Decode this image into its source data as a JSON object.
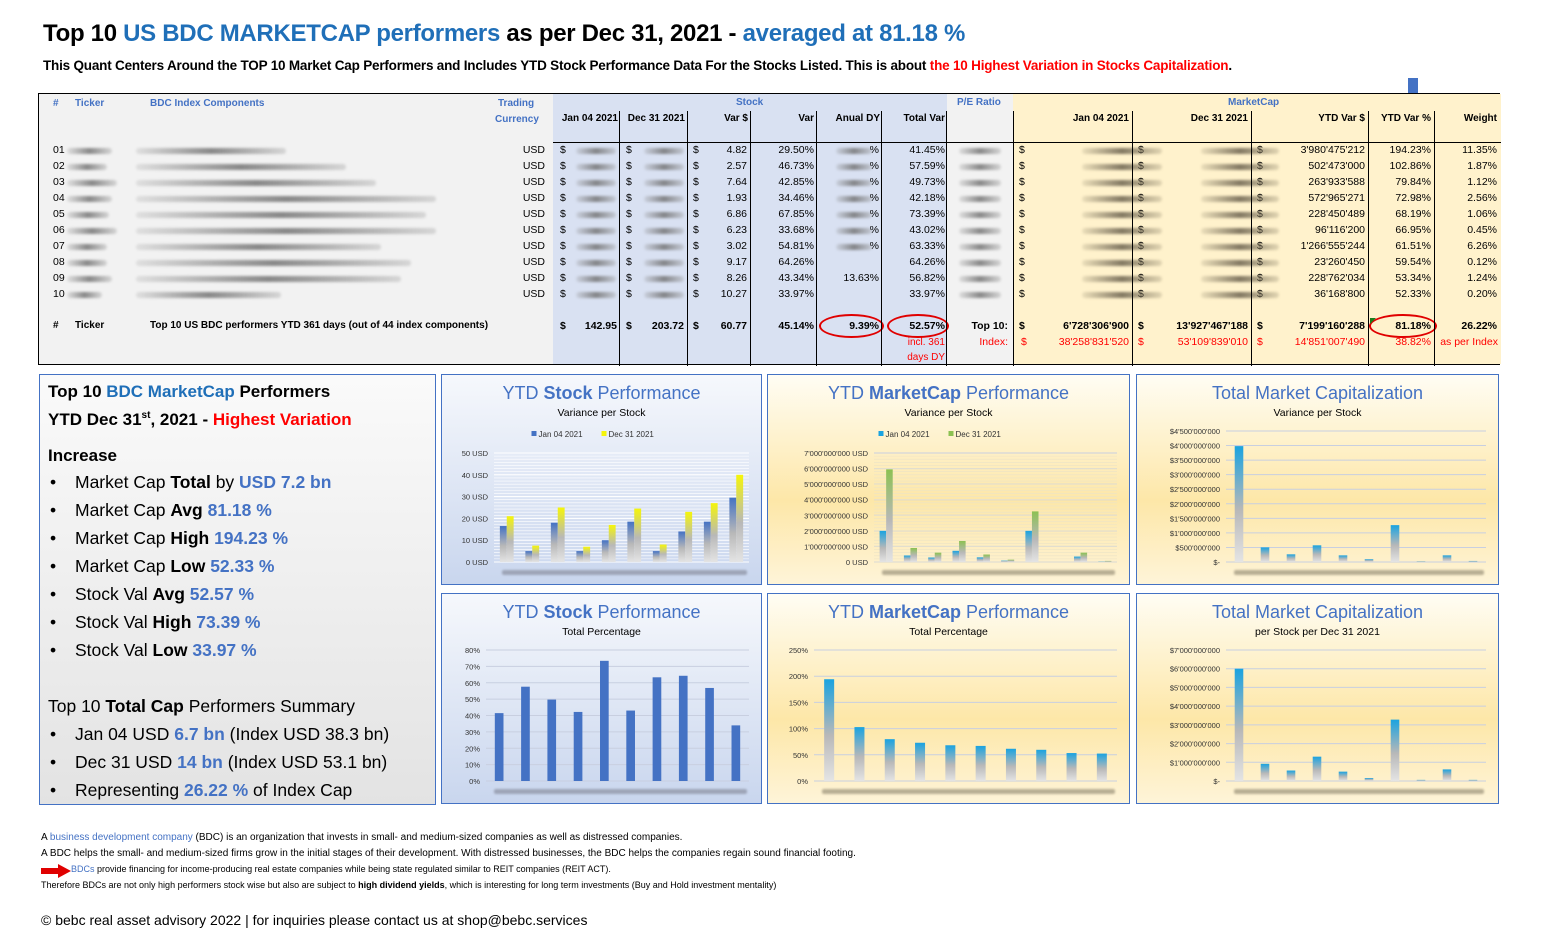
{
  "header": {
    "title_part1": "Top 10 ",
    "title_part2": "US BDC MARKETCAP performers",
    "title_part3": " as per Dec 31, 2021 -  ",
    "title_part4": "averaged at 81.18 %",
    "subtitle_part1": "This Quant Centers Around the TOP 10 Market Cap Performers and Includes YTD Stock Performance Data For the Stocks Listed. This is about ",
    "subtitle_part2": "the 10 Highest Variation in Stocks Capitalization",
    "subtitle_part3": "."
  },
  "table": {
    "headers": {
      "num": "#",
      "ticker": "Ticker",
      "components": "BDC Index Components",
      "trading": "Trading",
      "currency": "Currency",
      "stock_group": "Stock",
      "pe_group": "P/E Ratio",
      "mc_group": "MarketCap",
      "stock_jan": "Jan 04 2021",
      "stock_dec": "Dec 31 2021",
      "var_usd": "Var $",
      "var": "Var",
      "anual_dy": "Anual DY",
      "total_var": "Total Var",
      "mc_jan": "Jan 04 2021",
      "mc_dec": "Dec 31 2021",
      "ytd_var_usd": "YTD Var $",
      "ytd_var_pct": "YTD Var %",
      "weight": "Weight"
    },
    "rows": [
      {
        "num": "01",
        "currency": "USD",
        "var_usd": "4.82",
        "var": "29.50%",
        "dy": "%",
        "total_var": "41.45%",
        "ytd_var_usd": "3'980'475'212",
        "ytd_var_pct": "194.23%",
        "weight": "11.35%"
      },
      {
        "num": "02",
        "currency": "USD",
        "var_usd": "2.57",
        "var": "46.73%",
        "dy": "%",
        "total_var": "57.59%",
        "ytd_var_usd": "502'473'000",
        "ytd_var_pct": "102.86%",
        "weight": "1.87%"
      },
      {
        "num": "03",
        "currency": "USD",
        "var_usd": "7.64",
        "var": "42.85%",
        "dy": "%",
        "total_var": "49.73%",
        "ytd_var_usd": "263'933'588",
        "ytd_var_pct": "79.84%",
        "weight": "1.12%"
      },
      {
        "num": "04",
        "currency": "USD",
        "var_usd": "1.93",
        "var": "34.46%",
        "dy": "%",
        "total_var": "42.18%",
        "ytd_var_usd": "572'965'271",
        "ytd_var_pct": "72.98%",
        "weight": "2.56%"
      },
      {
        "num": "05",
        "currency": "USD",
        "var_usd": "6.86",
        "var": "67.85%",
        "dy": "%",
        "total_var": "73.39%",
        "ytd_var_usd": "228'450'489",
        "ytd_var_pct": "68.19%",
        "weight": "1.06%"
      },
      {
        "num": "06",
        "currency": "USD",
        "var_usd": "6.23",
        "var": "33.68%",
        "dy": "%",
        "total_var": "43.02%",
        "ytd_var_usd": "96'116'200",
        "ytd_var_pct": "66.95%",
        "weight": "0.45%"
      },
      {
        "num": "07",
        "currency": "USD",
        "var_usd": "3.02",
        "var": "54.81%",
        "dy": "%",
        "total_var": "63.33%",
        "ytd_var_usd": "1'266'555'244",
        "ytd_var_pct": "61.51%",
        "weight": "6.26%"
      },
      {
        "num": "08",
        "currency": "USD",
        "var_usd": "9.17",
        "var": "64.26%",
        "dy": "",
        "total_var": "64.26%",
        "ytd_var_usd": "23'260'450",
        "ytd_var_pct": "59.54%",
        "weight": "0.12%"
      },
      {
        "num": "09",
        "currency": "USD",
        "var_usd": "8.26",
        "var": "43.34%",
        "dy": "13.63%",
        "total_var": "56.82%",
        "ytd_var_usd": "228'762'034",
        "ytd_var_pct": "53.34%",
        "weight": "1.24%"
      },
      {
        "num": "10",
        "currency": "USD",
        "var_usd": "10.27",
        "var": "33.97%",
        "dy": "",
        "total_var": "33.97%",
        "ytd_var_usd": "36'168'800",
        "ytd_var_pct": "52.33%",
        "weight": "0.20%"
      }
    ],
    "currency_symbol": "$",
    "totals": {
      "num": "#",
      "ticker": "Ticker",
      "label": "Top 10 US BDC performers YTD 361 days (out of 44 index components)",
      "stock_jan": "142.95",
      "stock_dec": "203.72",
      "var_usd": "60.77",
      "var": "45.14%",
      "dy": "9.39%",
      "total_var": "52.57%",
      "total_var_note1": "incl.  361",
      "total_var_note2": "days DY",
      "top10_label": "Top 10:",
      "mc_jan": "6'728'306'900",
      "mc_dec": "13'927'467'188",
      "ytd_var_usd": "7'199'160'288",
      "ytd_var_pct": "81.18%",
      "weight": "26.22%",
      "index_label": "Index:",
      "index_mc_jan": "38'258'831'520",
      "index_mc_dec": "53'109'839'010",
      "index_ytd_var_usd": "14'851'007'490",
      "index_ytd_var_pct": "38.82%",
      "index_weight": "as per Index"
    }
  },
  "summary": {
    "h1_a": "Top 10 ",
    "h1_b": "BDC MarketCap",
    "h1_c": " Performers",
    "h2_a": "YTD Dec 31",
    "h2_sup": "st",
    "h2_b": ", 2021 - ",
    "h2_c": "Highest Variation",
    "increase": "Increase",
    "bullet": "•",
    "items": [
      {
        "pre": "Market Cap ",
        "bold": "Total",
        "mid": " by ",
        "val": "USD 7.2 bn",
        "post": ""
      },
      {
        "pre": "Market Cap ",
        "bold": "Avg",
        "mid": " ",
        "val": "81.18 %",
        "post": ""
      },
      {
        "pre": "Market Cap ",
        "bold": "High",
        "mid": " ",
        "val": "194.23 %",
        "post": ""
      },
      {
        "pre": "Market Cap ",
        "bold": "Low",
        "mid": " ",
        "val": "52.33 %",
        "post": ""
      },
      {
        "pre": "Stock Val ",
        "bold": "Avg",
        "mid": " ",
        "val": "52.57 %",
        "post": ""
      },
      {
        "pre": "Stock Val ",
        "bold": "High",
        "mid": " ",
        "val": "73.39 %",
        "post": ""
      },
      {
        "pre": "Stock Val ",
        "bold": "Low",
        "mid": " ",
        "val": "33.97 %",
        "post": ""
      }
    ],
    "cap_a": "Top 10 ",
    "cap_b": "Total Cap",
    "cap_c": " Performers Summary",
    "cap_items": [
      {
        "pre": "Jan 04 USD ",
        "val": "6.7 bn",
        "post": " (Index USD 38.3 bn)"
      },
      {
        "pre": "Dec 31 USD ",
        "val": "14 bn",
        "post": " (Index USD 53.1 bn)"
      },
      {
        "pre": "Representing ",
        "val": "26.22 %",
        "post": " of Index Cap"
      }
    ]
  },
  "chart_data": [
    {
      "id": "stock-variance",
      "type": "bar",
      "title_a": "YTD ",
      "title_b": "Stock",
      "title_c": " Performance",
      "subtitle": "Variance per Stock",
      "categories": [
        "1",
        "2",
        "3",
        "4",
        "5",
        "6",
        "7",
        "8",
        "9",
        "10"
      ],
      "series": [
        {
          "name": "Jan 04 2021",
          "color": "#4472c4",
          "values": [
            16.5,
            5,
            18,
            5,
            10,
            18.5,
            5,
            14,
            18.5,
            29.5
          ]
        },
        {
          "name": "Dec 31 2021",
          "color": "#f5f50a",
          "values": [
            21,
            7.5,
            25,
            7,
            17,
            24.5,
            8,
            23,
            27,
            40
          ]
        }
      ],
      "ylim": [
        0,
        50
      ],
      "yticks": [
        0,
        10,
        20,
        30,
        40,
        50
      ],
      "ytick_labels": [
        "0 USD",
        "10 USD",
        "20 USD",
        "30 USD",
        "40 USD",
        "50 USD"
      ],
      "legend": "top",
      "grid": true
    },
    {
      "id": "mc-variance",
      "type": "bar",
      "title_a": "YTD ",
      "title_b": "MarketCap",
      "title_c": " Performance",
      "subtitle": "Variance per Stock",
      "categories": [
        "1",
        "2",
        "3",
        "4",
        "5",
        "6",
        "7",
        "8",
        "9",
        "10"
      ],
      "series": [
        {
          "name": "Jan 04 2021",
          "color": "#1aa3e0",
          "values": [
            2000000000,
            420000000,
            290000000,
            720000000,
            300000000,
            90000000,
            2000000000,
            0,
            350000000,
            20000000
          ]
        },
        {
          "name": "Dec 31 2021",
          "color": "#8cc152",
          "values": [
            5950000000,
            900000000,
            600000000,
            1350000000,
            480000000,
            150000000,
            3250000000,
            0,
            600000000,
            70000000
          ]
        }
      ],
      "ylim": [
        0,
        7000000000
      ],
      "yticks": [
        0,
        1000000000,
        2000000000,
        3000000000,
        4000000000,
        5000000000,
        6000000000,
        7000000000
      ],
      "ytick_labels": [
        "0 USD",
        "1'000'000'000 USD",
        "2'000'000'000 USD",
        "3'000'000'000 USD",
        "4'000'000'000 USD",
        "5'000'000'000 USD",
        "6'000'000'000 USD",
        "7'000'000'000 USD"
      ],
      "legend": "top",
      "grid": true
    },
    {
      "id": "total-mc-variance",
      "type": "bar",
      "title_a": "",
      "title_b": "Total Market Capitalization",
      "title_c": "",
      "subtitle": "Variance per Stock",
      "categories": [
        "1",
        "2",
        "3",
        "4",
        "5",
        "6",
        "7",
        "8",
        "9",
        "10"
      ],
      "series": [
        {
          "name": "YTD Var $",
          "color": "#1aa3e0",
          "values": [
            3980475212,
            502473000,
            263933588,
            572965271,
            228450489,
            96116200,
            1266555244,
            23260450,
            228762034,
            36168800
          ]
        }
      ],
      "ylim": [
        0,
        4500000000
      ],
      "yticks": [
        0,
        500000000,
        1000000000,
        1500000000,
        2000000000,
        2500000000,
        3000000000,
        3500000000,
        4000000000,
        4500000000
      ],
      "ytick_labels": [
        "$-",
        "$500'000'000",
        "$1'000'000'000",
        "$1'500'000'000",
        "$2'000'000'000",
        "$2'500'000'000",
        "$3'000'000'000",
        "$3'500'000'000",
        "$4'000'000'000",
        "$4'500'000'000"
      ],
      "legend": "none",
      "grid": true
    },
    {
      "id": "stock-total-pct",
      "type": "bar",
      "title_a": "YTD ",
      "title_b": "Stock",
      "title_c": " Performance",
      "subtitle": "Total Percentage",
      "categories": [
        "1",
        "2",
        "3",
        "4",
        "5",
        "6",
        "7",
        "8",
        "9",
        "10"
      ],
      "series": [
        {
          "name": "Total Var",
          "color": "#4472c4",
          "values": [
            41.45,
            57.59,
            49.73,
            42.18,
            73.39,
            43.02,
            63.33,
            64.26,
            56.82,
            33.97
          ]
        }
      ],
      "ylim": [
        0,
        80
      ],
      "yticks": [
        0,
        10,
        20,
        30,
        40,
        50,
        60,
        70,
        80
      ],
      "ytick_labels": [
        "0%",
        "10%",
        "20%",
        "30%",
        "40%",
        "50%",
        "60%",
        "70%",
        "80%"
      ],
      "legend": "none",
      "grid": true
    },
    {
      "id": "mc-total-pct",
      "type": "bar",
      "title_a": "YTD ",
      "title_b": "MarketCap",
      "title_c": " Performance",
      "subtitle": "Total Percentage",
      "categories": [
        "1",
        "2",
        "3",
        "4",
        "5",
        "6",
        "7",
        "8",
        "9",
        "10"
      ],
      "series": [
        {
          "name": "YTD Var %",
          "color": "#1aa3e0",
          "values": [
            194.23,
            102.86,
            79.84,
            72.98,
            68.19,
            66.95,
            61.51,
            59.54,
            53.34,
            52.33
          ]
        }
      ],
      "ylim": [
        0,
        250
      ],
      "yticks": [
        0,
        50,
        100,
        150,
        200,
        250
      ],
      "ytick_labels": [
        "0%",
        "50%",
        "100%",
        "150%",
        "200%",
        "250%"
      ],
      "legend": "none",
      "grid": true
    },
    {
      "id": "total-mc-dec",
      "type": "bar",
      "title_a": "",
      "title_b": "Total Market Capitalization",
      "title_c": "",
      "subtitle": "per Stock per Dec 31 2021",
      "categories": [
        "1",
        "2",
        "3",
        "4",
        "5",
        "6",
        "7",
        "8",
        "9",
        "10"
      ],
      "series": [
        {
          "name": "Dec 31 2021",
          "color": "#1aa3e0",
          "values": [
            6000000000,
            920000000,
            560000000,
            1300000000,
            500000000,
            160000000,
            3280000000,
            60000000,
            620000000,
            60000000
          ]
        }
      ],
      "ylim": [
        0,
        7000000000
      ],
      "yticks": [
        0,
        1000000000,
        2000000000,
        3000000000,
        4000000000,
        5000000000,
        6000000000,
        7000000000
      ],
      "ytick_labels": [
        "$-",
        "$1'000'000'000",
        "$2'000'000'000",
        "$3'000'000'000",
        "$4'000'000'000",
        "$5'000'000'000",
        "$6'000'000'000",
        "$7'000'000'000"
      ],
      "legend": "none",
      "grid": true
    }
  ],
  "footer": {
    "l1_a": "A ",
    "l1_link": "business development company",
    "l1_b": " (BDC) is an organization that invests in small- and medium-sized companies as well as distressed companies.",
    "l2": "A BDC helps the small- and medium-sized firms grow in the initial stages of their development. With distressed businesses, the BDC helps the companies regain sound financial footing.",
    "l3_link": "BDCs",
    "l3": " provide financing for income-producing real estate companies while being state regulated similar to REIT companies (REIT ACT).",
    "l4_a": "Therefore BDCs are not only high performers stock wise but also are subject to ",
    "l4_b": "high dividend yields",
    "l4_c": ", which is interesting for long term investments (Buy and Hold investment mentality)",
    "copyright": "© bebc real asset advisory 2022 | for inquiries please contact us at shop@bebc.services"
  }
}
